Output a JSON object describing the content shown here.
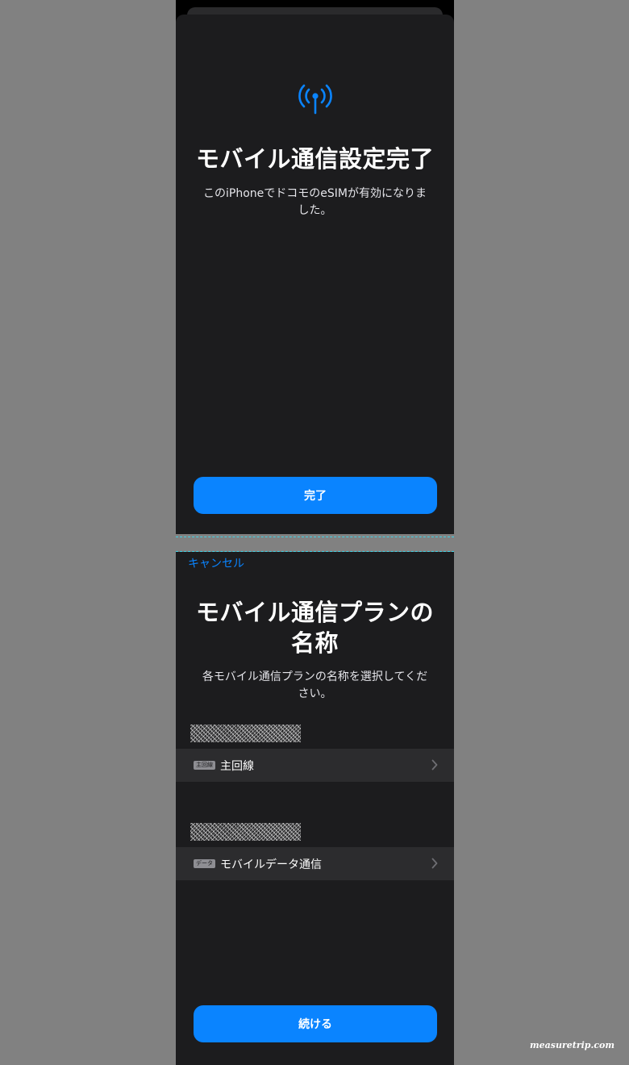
{
  "screen_complete": {
    "title": "モバイル通信設定完了",
    "description_line1": "このiPhoneでドコモのeSIMが有効になりま",
    "description_line2": "した。",
    "done_button": "完了",
    "icon": "antenna-radiowaves-icon"
  },
  "screen_plan_labels": {
    "cancel": "キャンセル",
    "title_line1": "モバイル通信プランの",
    "title_line2": "名称",
    "description_line1": "各モバイル通信プランの名称を選択してくだ",
    "description_line2": "さい。",
    "plans": [
      {
        "badge": "主回線",
        "label": "主回線"
      },
      {
        "badge": "データ",
        "label": "モバイルデータ通信"
      }
    ],
    "continue_button": "続ける"
  },
  "watermark": "measuretrip.com",
  "colors": {
    "accent": "#0a84ff",
    "background": "#1c1c1e",
    "row_background": "#2c2c2e",
    "outer_background": "#818181"
  }
}
